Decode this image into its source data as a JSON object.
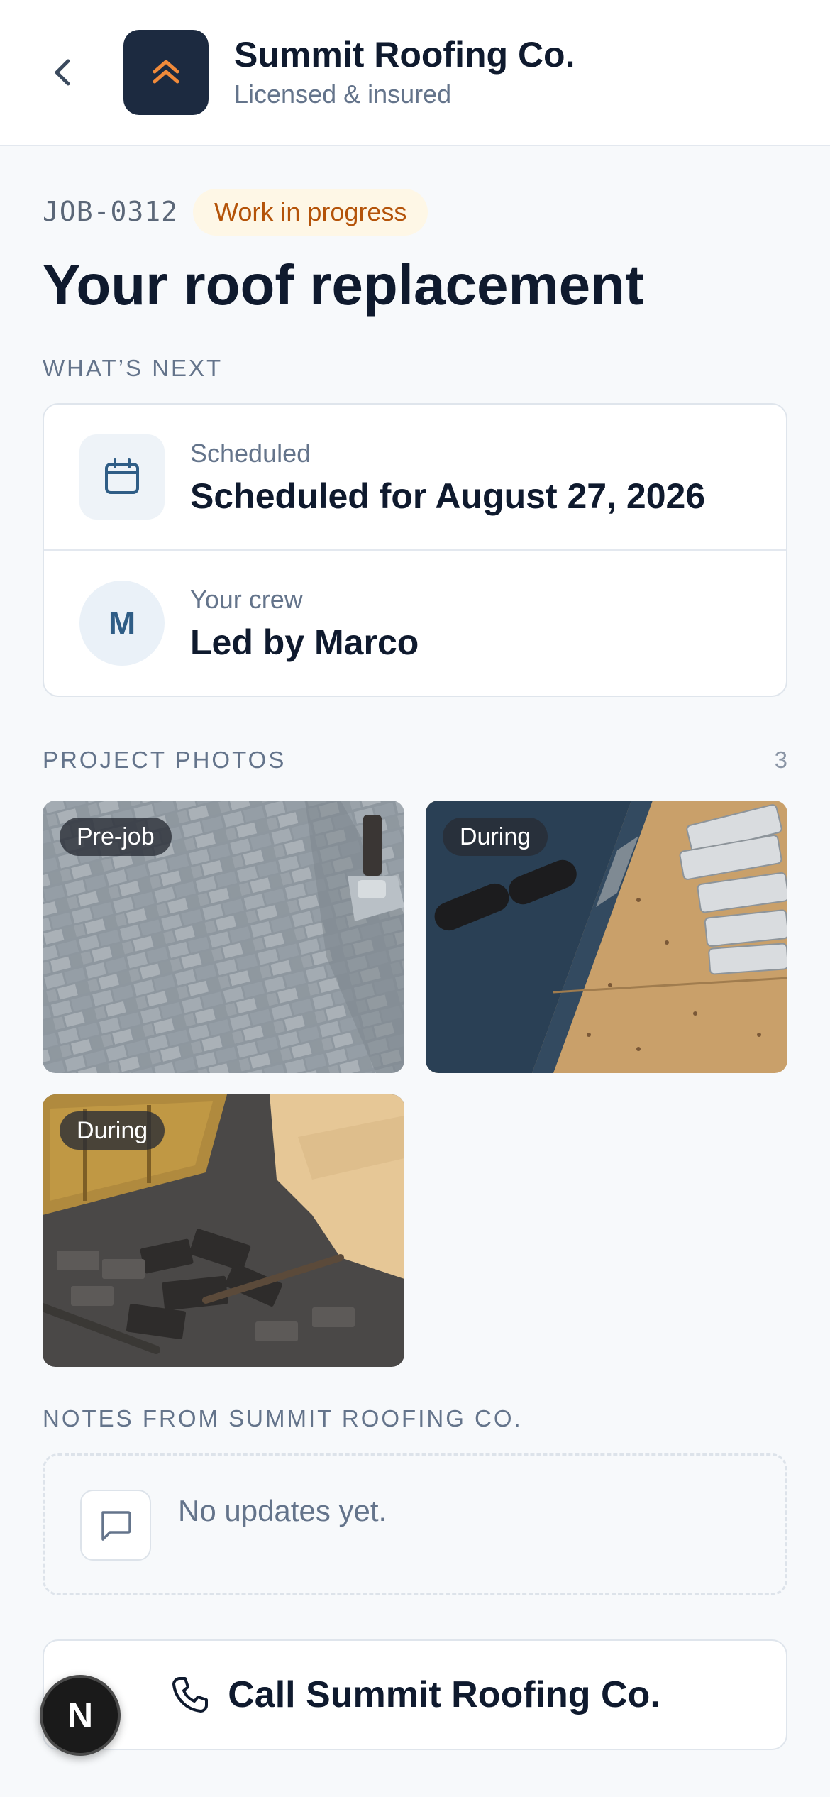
{
  "header": {
    "company_name": "Summit Roofing Co.",
    "company_subtitle": "Licensed & insured",
    "brand_color": "#1c2a40",
    "logo_accent": "#f08a3a"
  },
  "job": {
    "id": "JOB-0312",
    "status": "Work in progress",
    "title": "Your roof replacement"
  },
  "whats_next": {
    "section_label": "WHAT’S NEXT",
    "scheduled": {
      "label": "Scheduled",
      "value": "Scheduled for August 27, 2026",
      "icon": "calendar-icon"
    },
    "crew": {
      "label": "Your crew",
      "value": "Led by Marco",
      "avatar_initial": "M"
    }
  },
  "photos": {
    "section_label": "PROJECT PHOTOS",
    "count": "3",
    "items": [
      {
        "tag": "Pre-job"
      },
      {
        "tag": "During"
      },
      {
        "tag": "During"
      }
    ]
  },
  "notes": {
    "section_label": "NOTES FROM SUMMIT ROOFING CO.",
    "empty_text": "No updates yet."
  },
  "call_button": {
    "label": "Call Summit Roofing Co."
  },
  "dev_badge": {
    "letter": "N"
  }
}
